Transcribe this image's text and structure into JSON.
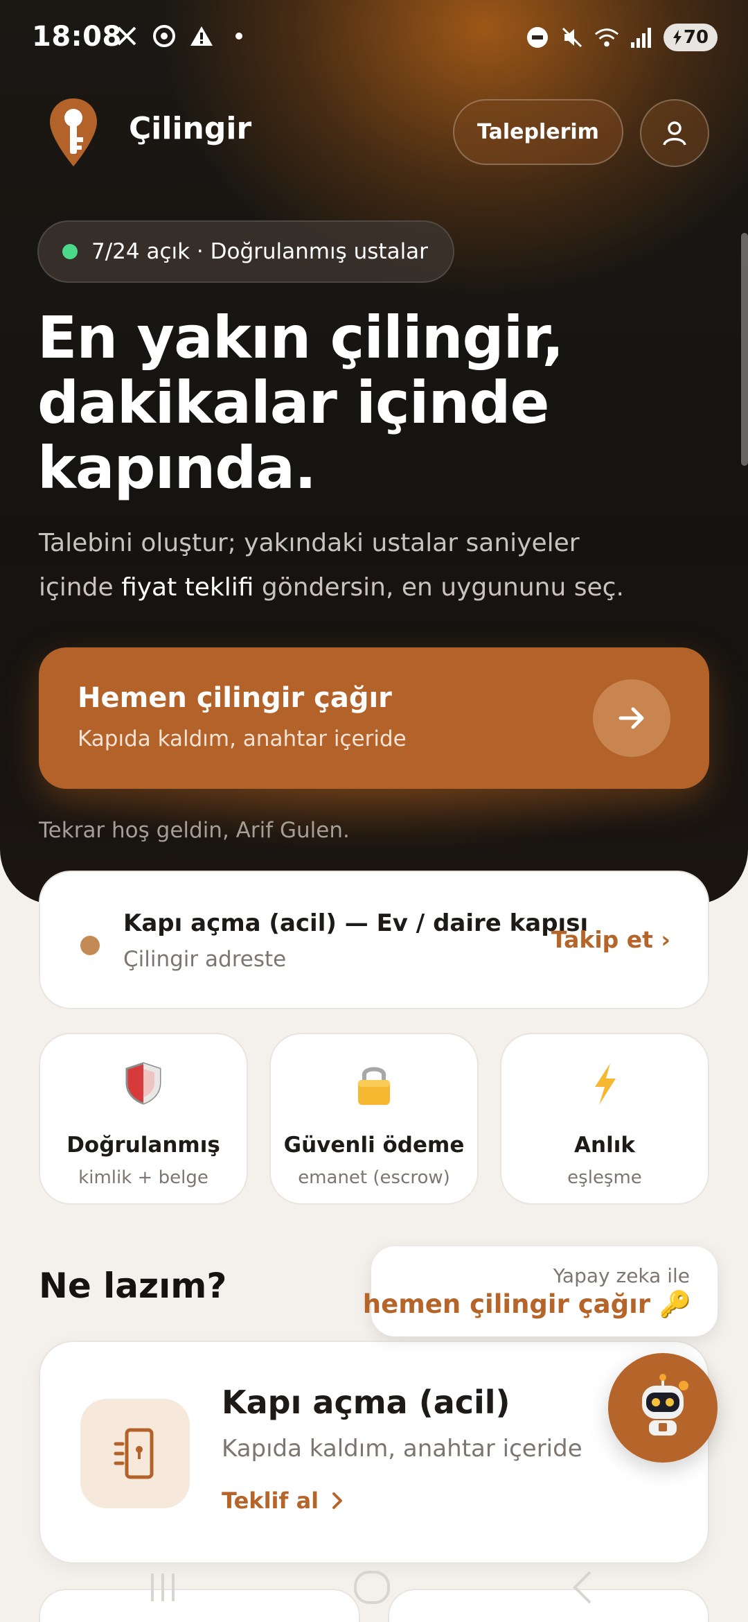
{
  "status_bar": {
    "time": "18:08",
    "battery": "70",
    "left_icons": [
      "x-icon",
      "chrome-icon",
      "warning-icon",
      "dot-icon"
    ],
    "right_icons": [
      "dnd-icon",
      "mute-icon",
      "wifi-icon",
      "signal-icon",
      "battery-icon"
    ]
  },
  "header": {
    "brand": "Çilingir",
    "requests_button": "Taleplerim"
  },
  "badge": {
    "text": "7/24 açık · Doğrulanmış ustalar"
  },
  "hero": {
    "headline_1": "En yakın çilingir,",
    "headline_2": "dakikalar içinde",
    "headline_3": "kapında.",
    "sub_part1": "Talebini oluştur; yakındaki ustalar saniyeler",
    "sub_part2": "içinde ",
    "sub_highlight": "fiyat teklifi",
    "sub_part3": " göndersin, en uygununu seç."
  },
  "cta": {
    "title": "Hemen çilingir çağır",
    "subtitle": "Kapıda kaldım, anahtar içeride"
  },
  "welcome": "Tekrar hoş geldin, Arif Gulen.",
  "active_request": {
    "title": "Kapı açma (acil) — Ev / daire kapısı",
    "status": "Çilingir adreste",
    "link": "Takip et ›"
  },
  "features": [
    {
      "icon": "shield-icon",
      "title": "Doğrulanmış",
      "subtitle": "kimlik + belge"
    },
    {
      "icon": "lock-icon",
      "title": "Güvenli ödeme",
      "subtitle": "emanet (escrow)"
    },
    {
      "icon": "lightning-icon",
      "title": "Anlık",
      "subtitle": "eşleşme"
    }
  ],
  "section": {
    "title": "Ne lazım?"
  },
  "ai_tip": {
    "top": "Yapay zeka ile",
    "main": "hemen çilingir çağır 🔑"
  },
  "service": {
    "title": "Kapı açma (acil)",
    "subtitle": "Kapıda kaldım, anahtar içeride",
    "link": "Teklif al"
  },
  "colors": {
    "accent": "#b3622a",
    "accent_text": "#b5642a",
    "background": "#f4f1ec",
    "hero_dark": "#151310",
    "online_dot": "#4bd98a"
  }
}
